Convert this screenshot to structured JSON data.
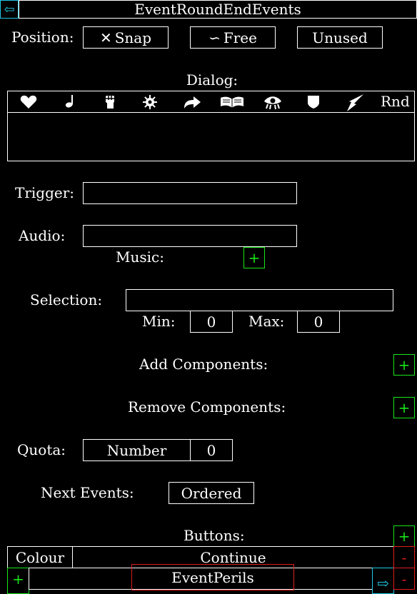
{
  "header": {
    "title": "EventRoundEndEvents",
    "back_glyph": "⇦"
  },
  "position": {
    "label": "Position:",
    "options": [
      {
        "glyph": "✕",
        "label": "Snap"
      },
      {
        "glyph": "∽",
        "label": "Free"
      },
      {
        "glyph": "",
        "label": "Unused"
      }
    ]
  },
  "dialog": {
    "label": "Dialog:",
    "icons": [
      "heart-icon",
      "note-icon",
      "fist-icon",
      "gear-icon",
      "arrow-icon",
      "book-icon",
      "eye-icon",
      "shield-icon",
      "bolt-icon"
    ],
    "random_label": "Rnd",
    "text": ""
  },
  "trigger": {
    "label": "Trigger:",
    "value": ""
  },
  "audio": {
    "label": "Audio:",
    "value": "",
    "music_label": "Music:"
  },
  "selection": {
    "label": "Selection:",
    "value": "",
    "min_label": "Min:",
    "min_value": "0",
    "max_label": "Max:",
    "max_value": "0"
  },
  "components": {
    "add_label": "Add Components:",
    "remove_label": "Remove Components:"
  },
  "quota": {
    "label": "Quota:",
    "type": "Number",
    "value": "0"
  },
  "next_events": {
    "label": "Next Events:",
    "mode": "Ordered"
  },
  "buttons": {
    "label": "Buttons:",
    "row1": {
      "colour": "Colour",
      "text": "Continue"
    },
    "row2": {
      "event": "EventPerils"
    }
  },
  "glyphs": {
    "plus": "+",
    "minus": "-",
    "forward": "⇨"
  },
  "colors": {
    "add": "#19e619",
    "nav": "#1ec8e6",
    "remove": "#e01c1c"
  }
}
